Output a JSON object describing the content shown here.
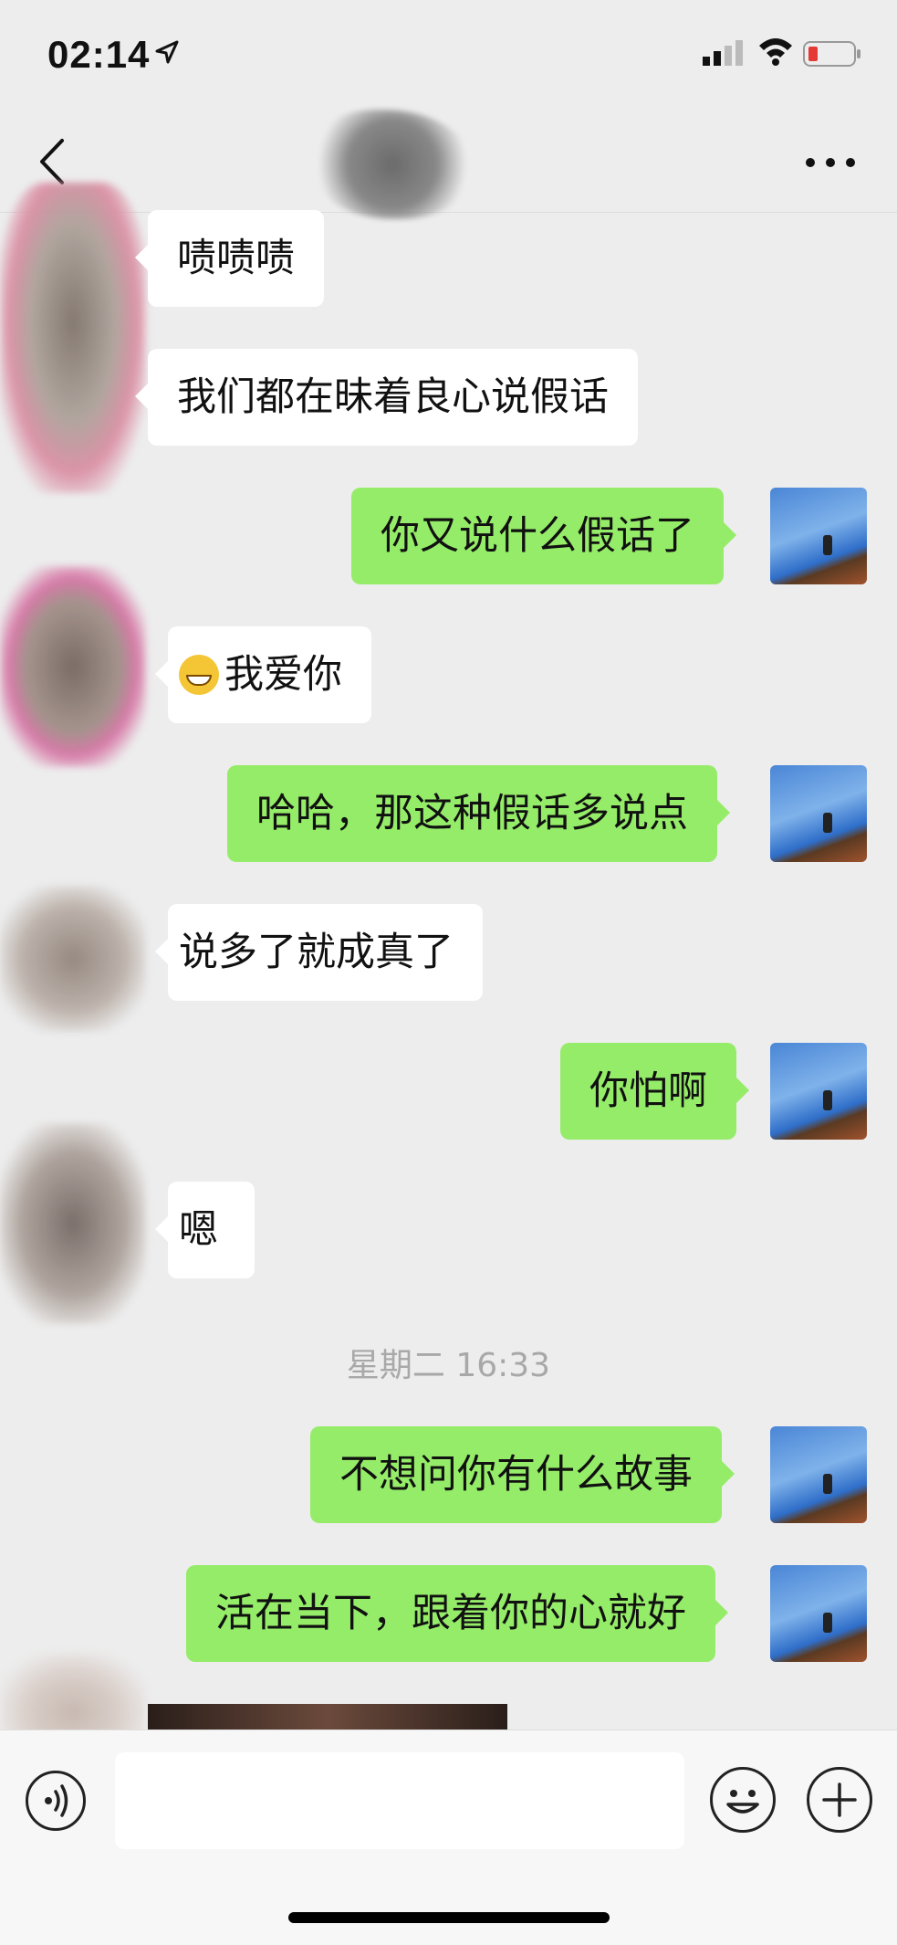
{
  "status_bar": {
    "time": "02:14",
    "icons": [
      "location-arrow-icon",
      "cellular-signal-icon",
      "wifi-icon",
      "battery-low-icon"
    ],
    "battery_color": "#e53935"
  },
  "nav": {
    "icons": [
      "chevron-left-icon",
      "more-dots-icon"
    ]
  },
  "colors": {
    "background": "#ededed",
    "incoming_bubble": "#ffffff",
    "outgoing_bubble": "#95ec69",
    "timestamp": "#a8a8a8"
  },
  "messages": [
    {
      "direction": "in",
      "text": "啧啧啧"
    },
    {
      "direction": "in",
      "text": "我们都在昧着良心说假话"
    },
    {
      "direction": "out",
      "text": "你又说什么假话了"
    },
    {
      "direction": "in",
      "text": "我爱你",
      "emoji": "grinning-face-icon"
    },
    {
      "direction": "out",
      "text": "哈哈，那这种假话多说点"
    },
    {
      "direction": "in",
      "text": "说多了就成真了"
    },
    {
      "direction": "out",
      "text": "你怕啊"
    },
    {
      "direction": "in",
      "text": "嗯"
    },
    {
      "direction": "out",
      "text": "不想问你有什么故事"
    },
    {
      "direction": "out",
      "text": "活在当下，跟着你的心就好"
    }
  ],
  "timestamp": "星期二 16:33",
  "input_bar": {
    "input_value": "",
    "icons": [
      "voice-icon",
      "emoji-icon",
      "plus-icon"
    ]
  }
}
